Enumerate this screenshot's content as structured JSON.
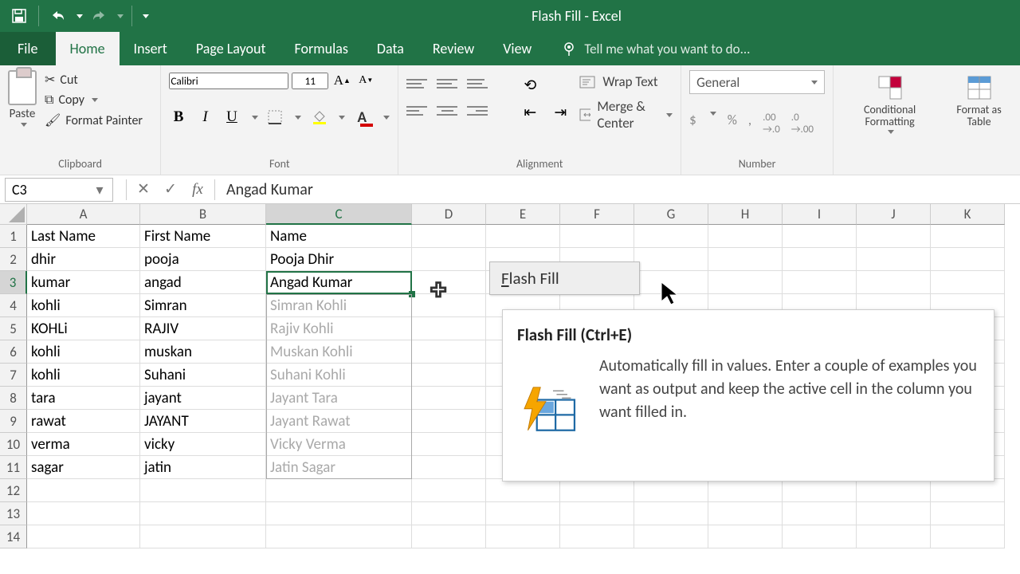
{
  "app": {
    "title": "Flash Fill - Excel"
  },
  "tabs": [
    "File",
    "Home",
    "Insert",
    "Page Layout",
    "Formulas",
    "Data",
    "Review",
    "View"
  ],
  "tellme": "Tell me what you want to do...",
  "clipboard": {
    "paste": "Paste",
    "cut": "Cut",
    "copy": "Copy",
    "painter": "Format Painter",
    "label": "Clipboard"
  },
  "font": {
    "name": "Calibri",
    "size": "11",
    "label": "Font"
  },
  "alignment": {
    "wrap": "Wrap Text",
    "merge": "Merge & Center",
    "label": "Alignment"
  },
  "number": {
    "format": "General",
    "label": "Number"
  },
  "styles": {
    "conditional": "Conditional Formatting",
    "formatTable": "Format as Table"
  },
  "namebox": "C3",
  "formula": "Angad Kumar",
  "columns": [
    "A",
    "B",
    "C",
    "D",
    "E",
    "F",
    "G",
    "H",
    "I",
    "J",
    "K"
  ],
  "headers": {
    "a": "Last Name",
    "b": "First Name",
    "c": "Name"
  },
  "rows": [
    {
      "a": "dhir",
      "b": "pooja",
      "c": "Pooja Dhir",
      "suggest": false
    },
    {
      "a": "kumar",
      "b": "angad",
      "c": "Angad Kumar",
      "suggest": false
    },
    {
      "a": "kohli",
      "b": "Simran",
      "c": "Simran Kohli",
      "suggest": true
    },
    {
      "a": "KOHLi",
      "b": "RAJIV",
      "c": "Rajiv Kohli",
      "suggest": true
    },
    {
      "a": "kohli",
      "b": "muskan",
      "c": "Muskan Kohli",
      "suggest": true
    },
    {
      "a": "kohli",
      "b": "Suhani",
      "c": "Suhani Kohli",
      "suggest": true
    },
    {
      "a": "tara",
      "b": "jayant",
      "c": "Jayant Tara",
      "suggest": true
    },
    {
      "a": "rawat",
      "b": "JAYANT",
      "c": "Jayant Rawat",
      "suggest": true
    },
    {
      "a": "verma",
      "b": "vicky",
      "c": "Vicky Verma",
      "suggest": true
    },
    {
      "a": "sagar",
      "b": "jatin",
      "c": "Jatin Sagar",
      "suggest": true
    }
  ],
  "flashfill": {
    "button": "Flash Fill",
    "title": "Flash Fill (Ctrl+E)",
    "desc": "Automatically fill in values. Enter a couple of examples you want as output and keep the active cell in the column you want filled in."
  }
}
